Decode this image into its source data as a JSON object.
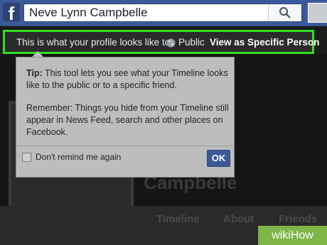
{
  "header": {
    "logo": "f",
    "search_value": "Neve Lynn Campbelle"
  },
  "banner": {
    "prefix": "This is what your profile looks like to:",
    "audience": "Public",
    "view_as": "View as Specific Person"
  },
  "popup": {
    "tip_label": "Tip:",
    "tip_text": "This tool lets you see what your Timeline looks like to the public or to a specific friend.",
    "remember_text": "Remember: Things you hide from your Timeline still appear in News Feed, search and other places on Facebook.",
    "remind_label": "Don't remind me again",
    "ok_label": "OK"
  },
  "profile": {
    "name": "Campbelle"
  },
  "nav": {
    "timeline": "Timeline",
    "about": "About",
    "friends": "Friends"
  },
  "watermark": "wikiHow",
  "colors": {
    "brand": "#3b5998",
    "highlight": "#33dd22",
    "watermark": "#7fb446"
  }
}
